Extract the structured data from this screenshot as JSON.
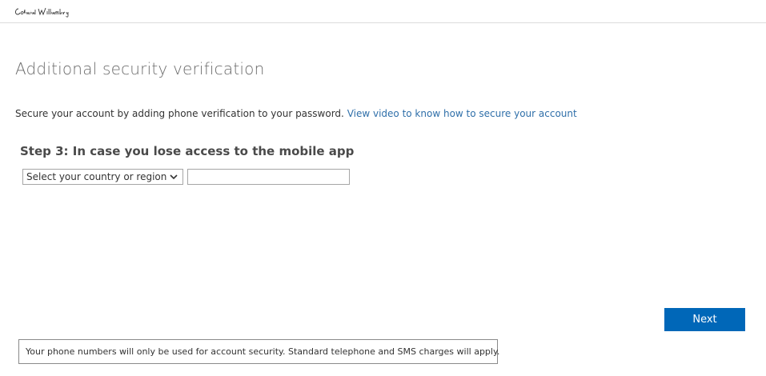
{
  "header": {
    "logo_text": "Colonial Williamsburg"
  },
  "main": {
    "title": "Additional security verification",
    "intro_text": "Secure your account by adding phone verification to your password.",
    "intro_link": "View video to know how to secure your account",
    "step_title": "Step 3: In case you lose access to the mobile app",
    "country_select": {
      "selected": "Select your country or region"
    },
    "phone_input": {
      "value": "",
      "placeholder": ""
    },
    "next_label": "Next"
  },
  "footer": {
    "notice": "Your phone numbers will only be used for account security. Standard telephone and SMS charges will apply."
  },
  "colors": {
    "accent": "#0067b8",
    "link": "#2f6fa9",
    "title": "#6b6b6b"
  }
}
